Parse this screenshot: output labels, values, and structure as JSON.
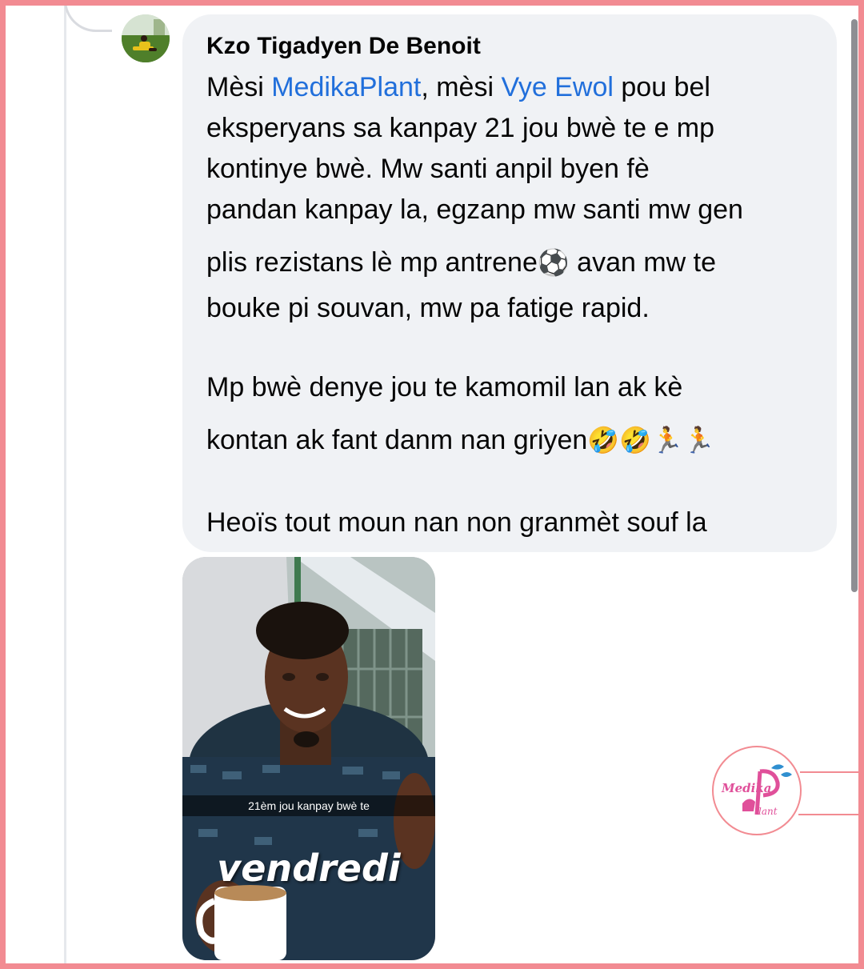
{
  "comment": {
    "author": "Kzo Tigadyen De Benoit",
    "lines": {
      "l1_a": "Mèsi ",
      "l1_mention1": "MedikaPlant",
      "l1_b": ", mèsi ",
      "l1_mention2": "Vye Ewol",
      "l1_c": " pou bel",
      "l2": "eksperyans sa kanpay 21 jou bwè te  e mp",
      "l3": "kontinye bwè. Mw santi anpil byen fè",
      "l4": "pandan kanpay la, egzanp mw santi mw gen",
      "l5_a": "plis rezistans lè mp antrene",
      "l5_emoji": "⚽",
      "l5_b": " avan mw te",
      "l6": "bouke pi souvan, mw pa fatige rapid.",
      "l7": "Mp bwè denye jou te kamomil lan ak kè",
      "l8_a": "kontan ak fant danm nan griyen",
      "l8_emoji": "🤣🤣🏃🏃",
      "l9": "Heoïs tout moun nan non granmèt souf la"
    }
  },
  "photo": {
    "caption": "21èm jou kanpay bwè te",
    "day": "vendredi"
  },
  "watermark": {
    "text_top": "Medika",
    "text_bottom": "Plant"
  },
  "colors": {
    "frame": "#f28b92",
    "mention": "#216fdb",
    "bubble": "#f0f2f5"
  }
}
